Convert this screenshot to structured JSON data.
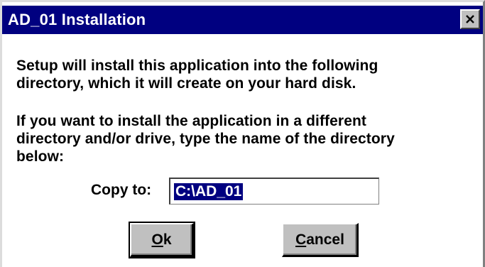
{
  "window": {
    "title": "AD_01 Installation",
    "close_icon": "close-icon"
  },
  "message": {
    "line1": "Setup will install this application into the following",
    "line2": "directory, which it will create on your hard disk.",
    "line3": "If you want to install the application in a different",
    "line4": "directory and/or drive, type the name of the directory",
    "line5": "below:"
  },
  "copy_to": {
    "label": "Copy to:",
    "value": "C:\\AD_01"
  },
  "buttons": {
    "ok_mnemonic": "O",
    "ok_rest": "k",
    "cancel_mnemonic": "C",
    "cancel_rest": "ancel"
  },
  "colors": {
    "titlebar": "#000080",
    "face": "#c0c0c0",
    "selection": "#000080"
  }
}
